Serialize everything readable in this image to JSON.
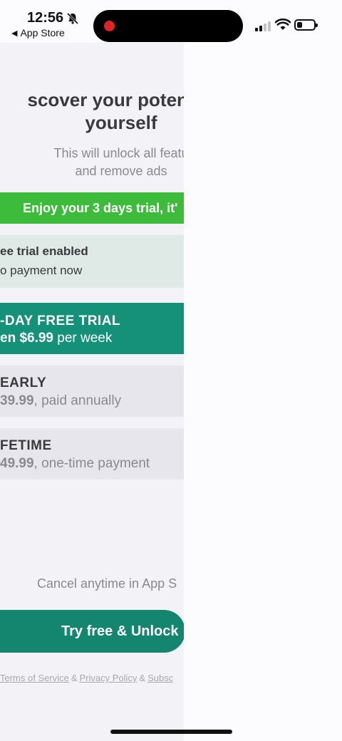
{
  "status_bar": {
    "time": "12:56",
    "back_label": "App Store",
    "battery_level": 0.3,
    "signal_bars": 2
  },
  "paywall": {
    "headline_line1": "scover your potential",
    "headline_line2": "yourself",
    "subtext_line1": "This will unlock all featu",
    "subtext_line2": "and remove ads",
    "trial_banner": "Enjoy your 3 days trial, it'",
    "toggle": {
      "title": "ee trial enabled",
      "subtitle": "o payment now"
    },
    "plans": [
      {
        "title": "-DAY FREE TRIAL",
        "price": "en $6.99",
        "suffix": " per week",
        "selected": true
      },
      {
        "title": "EARLY",
        "price": "39.99",
        "suffix": ", paid annually",
        "selected": false
      },
      {
        "title": "FETIME",
        "price": "49.99",
        "suffix": ", one-time payment",
        "selected": false
      }
    ],
    "cancel_note": "Cancel anytime in App S",
    "cta_label": "Try free & Unlock",
    "legal": {
      "terms": "Terms of Service",
      "sep1": "&",
      "privacy": "Privacy Policy",
      "sep2": "&",
      "subscription": "Subsc"
    }
  },
  "colors": {
    "accent": "#159179",
    "banner_green": "#3dbb3a",
    "cta": "#14866f"
  }
}
